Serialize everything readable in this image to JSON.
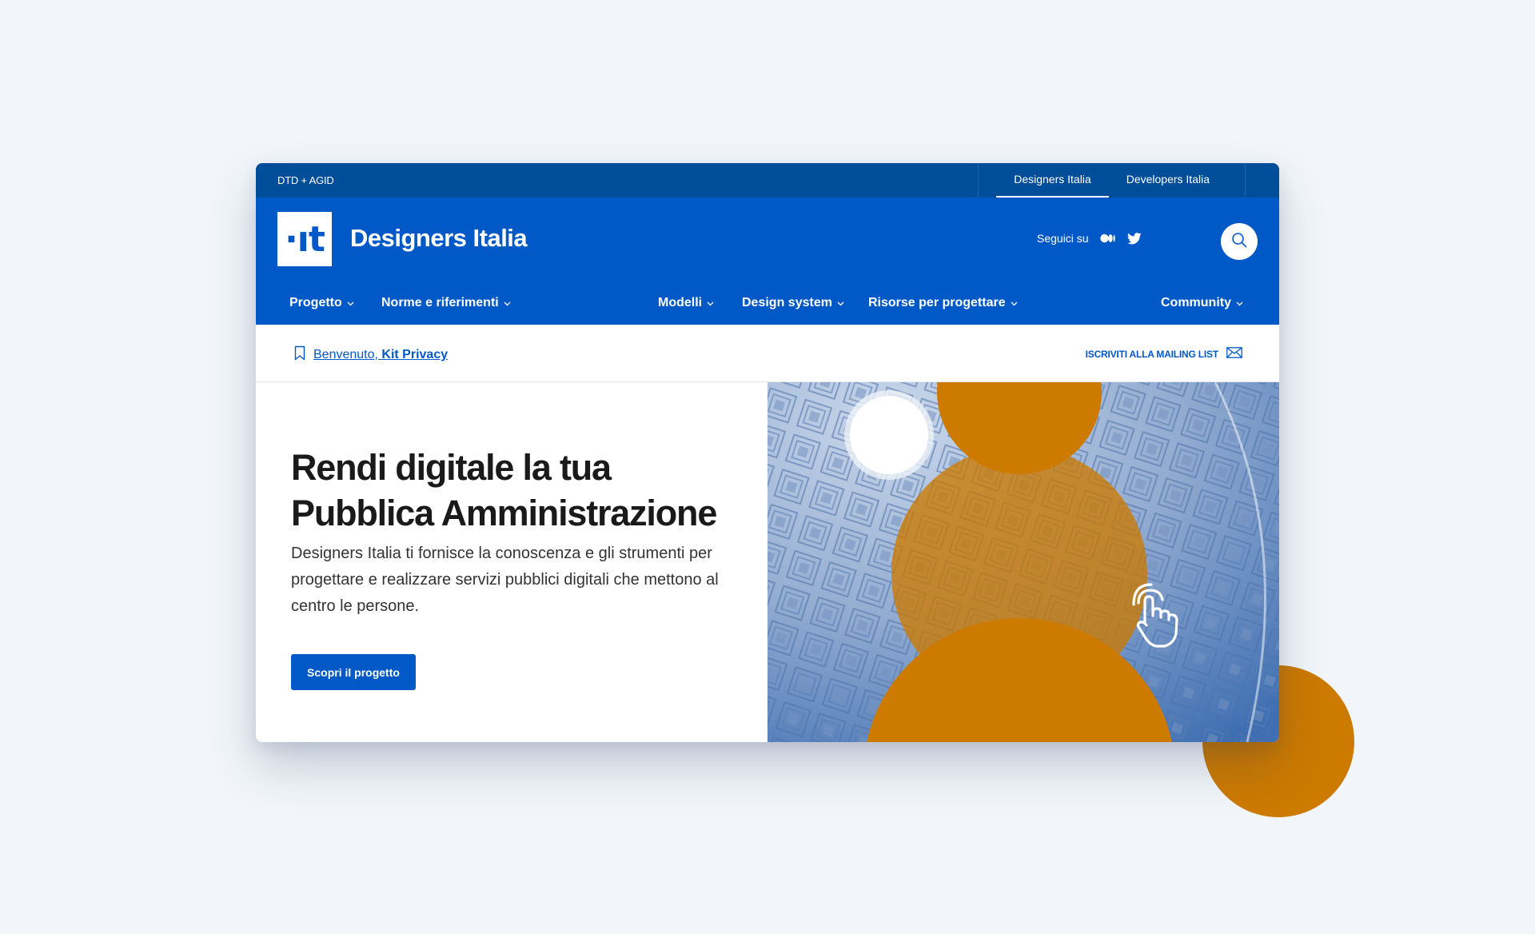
{
  "colors": {
    "primary": "#0059c7",
    "slim": "#004d99",
    "accent": "#cc7a00",
    "background": "#f2f6fa",
    "text": "#1a1a1a"
  },
  "slim_header": {
    "brand": "DTD + AGID",
    "links": [
      {
        "label": "Designers Italia",
        "active": true
      },
      {
        "label": "Developers Italia",
        "active": false
      }
    ]
  },
  "header": {
    "logo_text": "·ıt",
    "title": "Designers Italia",
    "follow_label": "Seguici su",
    "social_icons": [
      "medium-icon",
      "twitter-icon"
    ],
    "search_icon": "search-icon"
  },
  "nav": {
    "items": [
      {
        "label": "Progetto"
      },
      {
        "label": "Norme e riferimenti"
      },
      {
        "label": "Modelli"
      },
      {
        "label": "Design system"
      },
      {
        "label": "Risorse per progettare"
      },
      {
        "label": "Community"
      }
    ]
  },
  "breadcrumb": {
    "prefix": "Benvenuto, ",
    "current": "Kit Privacy",
    "icon": "bookmark-icon",
    "mailing_label": "ISCRIVITI ALLA MAILING LIST",
    "mailing_icon": "mail-icon"
  },
  "hero": {
    "title": "Rendi digitale la tua Pubblica Amministrazione",
    "text": "Designers Italia ti fornisce la conoscenza e gli strumenti per progettare e realizzare servizi pubblici digitali che mettono al centro le persone.",
    "button_label": "Scopri il progetto",
    "image_icon": "pointing-hand-icon"
  }
}
